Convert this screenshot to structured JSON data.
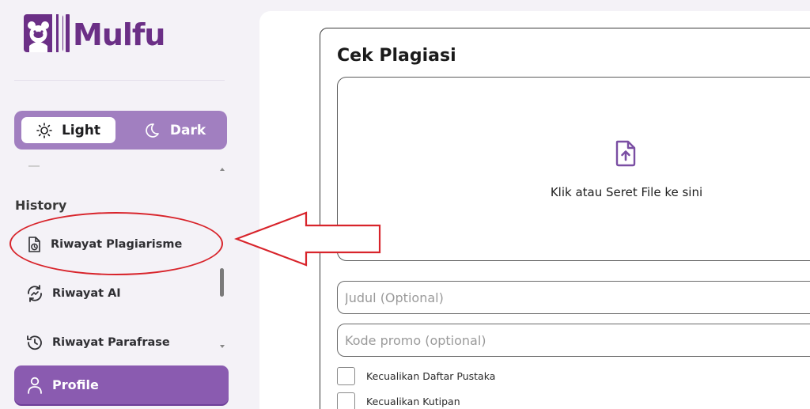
{
  "brand": {
    "name": "Mulfu",
    "color": "#6b2f86"
  },
  "theme_toggle": {
    "light_label": "Light",
    "dark_label": "Dark",
    "selected": "Light"
  },
  "sidebar": {
    "history_title": "History",
    "items": [
      {
        "label": "Riwayat Plagiarisme",
        "icon": "document-clock-icon"
      },
      {
        "label": "Riwayat AI",
        "icon": "refresh-chart-icon"
      },
      {
        "label": "Riwayat Parafrase",
        "icon": "history-icon"
      }
    ],
    "profile_label": "Profile",
    "profile_icon": "user-icon"
  },
  "main": {
    "title": "Cek Plagiasi",
    "dropzone_text": "Klik atau Seret File ke sini",
    "dropzone_icon": "file-upload-icon",
    "title_field_placeholder": "Judul (Optional)",
    "promo_field_placeholder": "Kode promo (optional)",
    "checkboxes": [
      {
        "label": "Kecualikan Daftar Pustaka",
        "checked": false
      },
      {
        "label": "Kecualikan Kutipan",
        "checked": false
      }
    ]
  },
  "colors": {
    "accent": "#8a5bb0",
    "toggle_bg": "#a17fc0",
    "annotation": "#d8242b"
  }
}
